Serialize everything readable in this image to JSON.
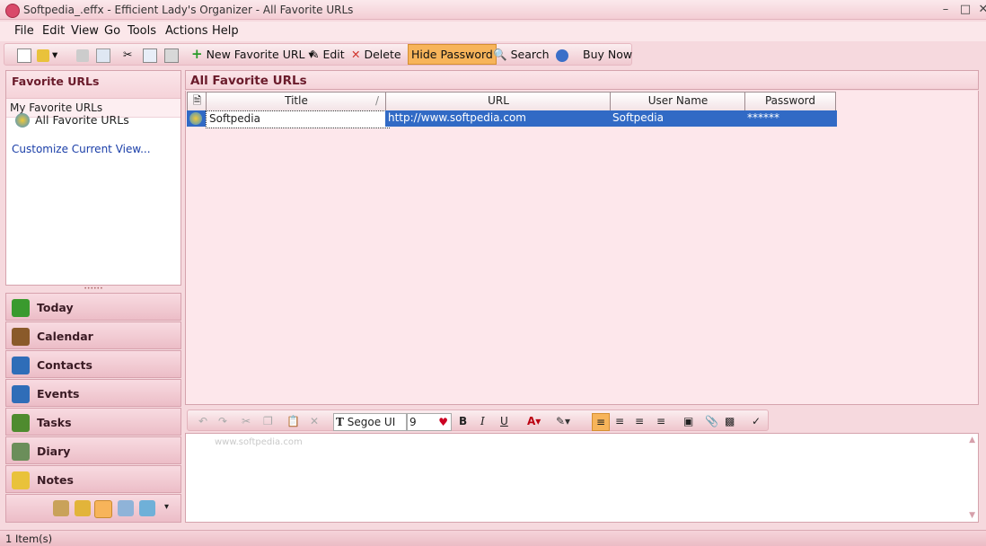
{
  "window": {
    "title": "Softpedia_.effx - Efficient Lady's Organizer - All Favorite URLs"
  },
  "menu": [
    "File",
    "Edit",
    "View",
    "Go",
    "Tools",
    "Actions",
    "Help"
  ],
  "toolbar": {
    "new_favorite_url": "New Favorite URL",
    "edit": "Edit",
    "delete": "Delete",
    "hide_password": "Hide Password",
    "search": "Search",
    "buy_now": "Buy Now"
  },
  "left_pane": {
    "header": "Favorite URLs",
    "group": "My Favorite URLs",
    "selected_item": "All Favorite URLs",
    "customize_link": "Customize Current View..."
  },
  "nav": [
    {
      "label": "Today",
      "color": "#3a9a2e"
    },
    {
      "label": "Calendar",
      "color": "#8a5a2a"
    },
    {
      "label": "Contacts",
      "color": "#2f6db8"
    },
    {
      "label": "Events",
      "color": "#2f6db8"
    },
    {
      "label": "Tasks",
      "color": "#4f8b2f"
    },
    {
      "label": "Diary",
      "color": "#6b8e5a"
    },
    {
      "label": "Notes",
      "color": "#e9c23b"
    }
  ],
  "main": {
    "header": "All Favorite URLs",
    "columns": [
      "Title",
      "URL",
      "User Name",
      "Password"
    ],
    "rows": [
      {
        "title": "Softpedia",
        "url": "http://www.softpedia.com",
        "user": "Softpedia",
        "password": "******"
      }
    ]
  },
  "format_bar": {
    "font": "Segoe UI",
    "size": "9"
  },
  "editor": {
    "watermark": "www.softpedia.com"
  },
  "status": {
    "text": "1 Item(s)"
  },
  "colors": {
    "accent": "#6a1b2b",
    "selection": "#316ac5",
    "hide_password_bg": "#f7b45a"
  }
}
